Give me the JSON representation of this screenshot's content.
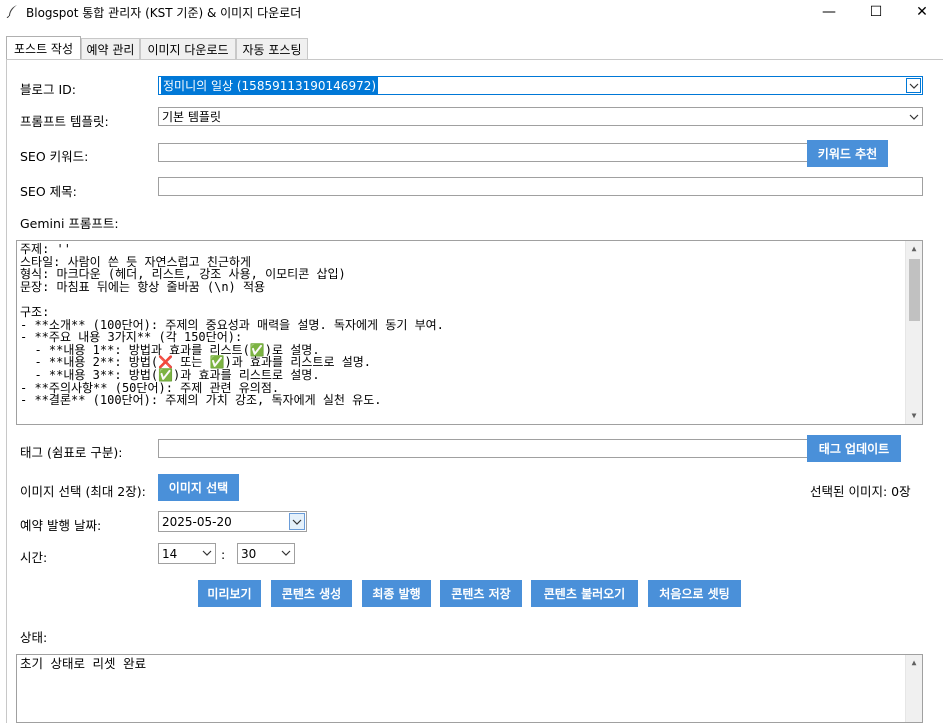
{
  "window": {
    "title": "Blogspot 통합 관리자 (KST 기준) & 이미지 다운로더",
    "minimize_glyph": "—",
    "maximize_glyph": "☐",
    "close_glyph": "✕"
  },
  "tabs": [
    {
      "label": "포스트 작성",
      "active": true
    },
    {
      "label": "예약 관리",
      "active": false
    },
    {
      "label": "이미지 다운로드",
      "active": false
    },
    {
      "label": "자동 포스팅",
      "active": false
    }
  ],
  "form": {
    "blog_id_label": "블로그 ID:",
    "blog_id_value": "정미니의 일상 (15859113190146972)",
    "template_label": "프롬프트 템플릿:",
    "template_value": "기본 템플릿",
    "seo_keyword_label": "SEO 키워드:",
    "seo_keyword_value": "",
    "keyword_recommend_button": "키워드 추천",
    "seo_title_label": "SEO 제목:",
    "seo_title_value": "",
    "gemini_prompt_label": "Gemini 프롬프트:",
    "prompt_lines": [
      "주제: ''",
      "스타일: 사람이 쓴 듯 자연스럽고 친근하게",
      "형식: 마크다운 (헤더, 리스트, 강조 사용, 이모티콘 삽입)",
      "문장: 마침표 뒤에는 항상 줄바꿈 (\\n) 적용",
      "",
      "구조:",
      "- **소개** (100단어): 주제의 중요성과 매력을 설명. 독자에게 동기 부여.",
      "- **주요 내용 3가지** (각 150단어):",
      "  - **내용 1**: 방법과 효과를 리스트(✅)로 설명.",
      "  - **내용 2**: 방법(❌ 또는 ✅)과 효과를 리스트로 설명.",
      "  - **내용 3**: 방법(✅)과 효과를 리스트로 설명.",
      "- **주의사항** (50단어): 주제 관련 유의점.",
      "- **결론** (100단어): 주제의 가치 강조, 독자에게 실천 유도."
    ],
    "tags_label": "태그 (쉼표로 구분):",
    "tags_value": "",
    "tag_update_button": "태그 업데이트",
    "image_select_label": "이미지 선택 (최대 2장):",
    "image_select_button": "이미지 선택",
    "selected_images_text": "선택된 이미지: 0장",
    "schedule_date_label": "예약 발행 날짜:",
    "schedule_date_value": "2025-05-20",
    "time_label": "시간:",
    "hour_value": "14",
    "time_separator": ":",
    "minute_value": "30"
  },
  "actions": [
    {
      "name": "preview-button",
      "label": "미리보기"
    },
    {
      "name": "generate-content-button",
      "label": "콘텐츠 생성"
    },
    {
      "name": "final-publish-button",
      "label": "최종 발행"
    },
    {
      "name": "save-content-button",
      "label": "콘텐츠 저장"
    },
    {
      "name": "load-content-button",
      "label": "콘텐츠 불러오기"
    },
    {
      "name": "reset-settings-button",
      "label": "처음으로 셋팅"
    }
  ],
  "status": {
    "label": "상태:",
    "text": "초기 상태로 리셋 완료"
  },
  "colors": {
    "accent_button": "#4a90d9",
    "selection_highlight": "#0078d7"
  }
}
